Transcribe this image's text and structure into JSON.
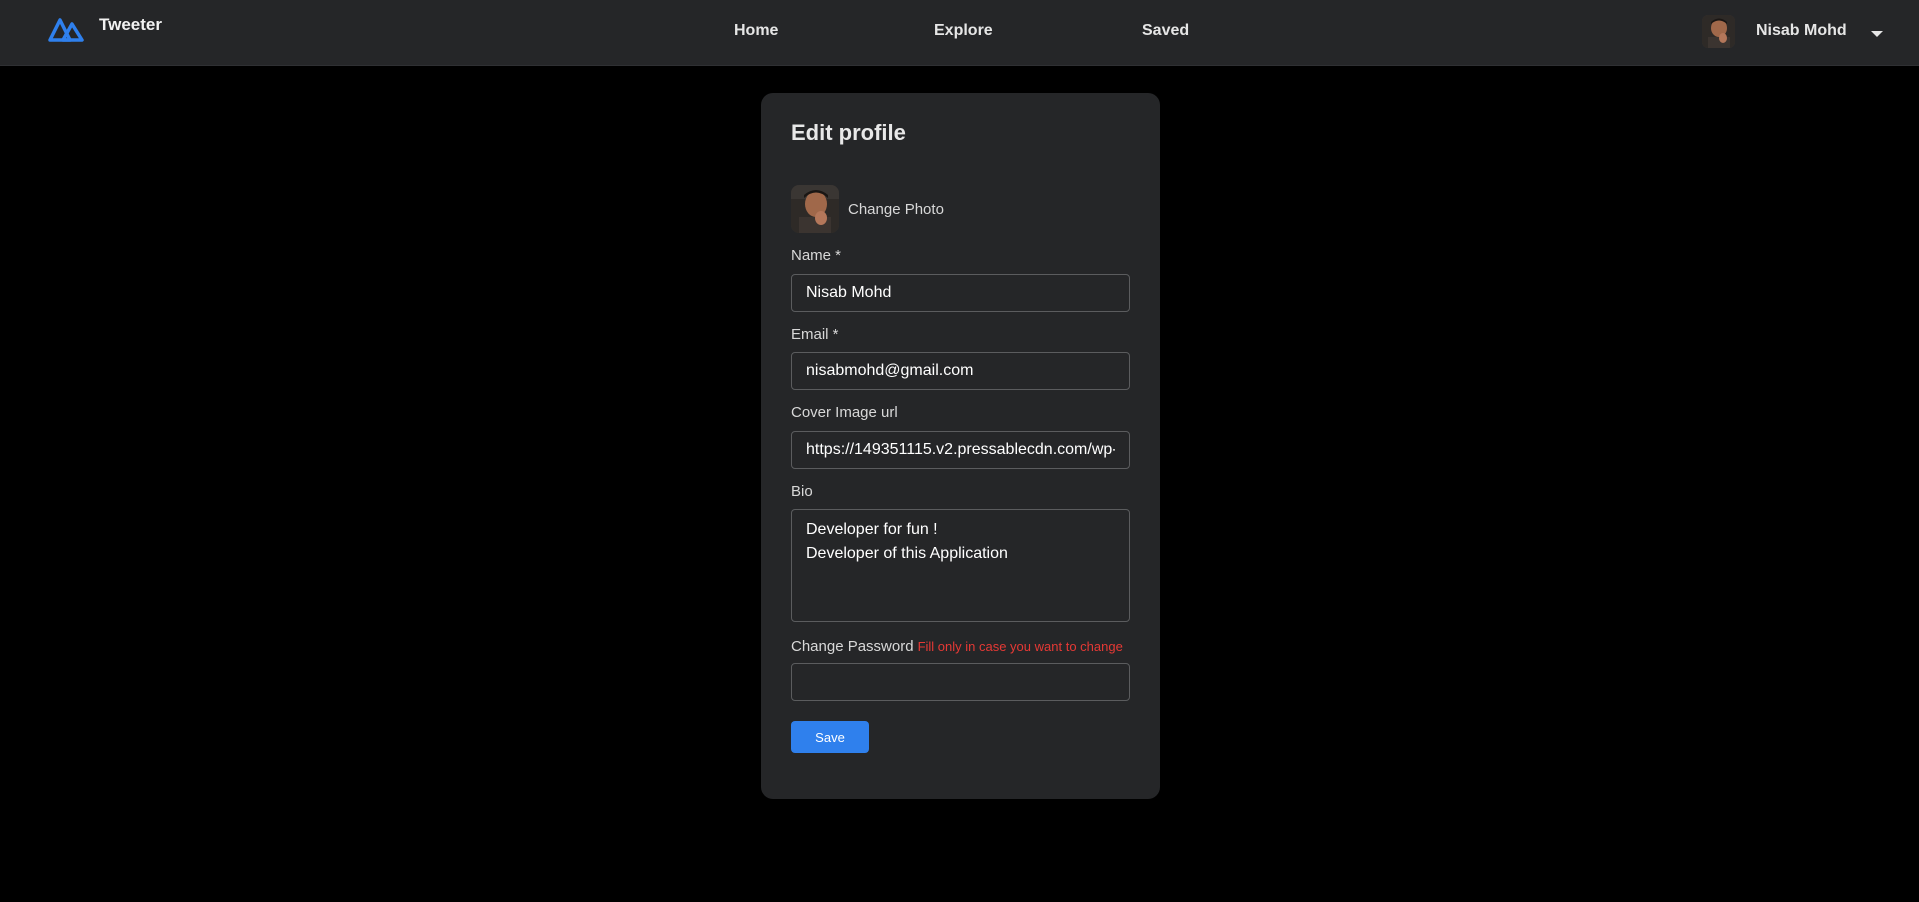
{
  "navbar": {
    "brand_name": "Tweeter",
    "links": {
      "home": "Home",
      "explore": "Explore",
      "saved": "Saved"
    },
    "user_name": "Nisab Mohd"
  },
  "edit_profile": {
    "title": "Edit profile",
    "change_photo_label": "Change Photo",
    "name_label": "Name *",
    "name_value": "Nisab Mohd",
    "email_label": "Email *",
    "email_value": "nisabmohd@gmail.com",
    "cover_label": "Cover Image url",
    "cover_value": "https://149351115.v2.pressablecdn.com/wp-",
    "bio_label": "Bio",
    "bio_value": "Developer for fun !\nDeveloper of this Application",
    "password_label": "Change Password",
    "password_hint": "Fill only in case you want to change",
    "password_value": "",
    "save_label": "Save"
  },
  "colors": {
    "accent": "#2f80ed",
    "warning": "#e53935",
    "card_bg": "#252628",
    "page_bg": "#000000"
  },
  "icons": {
    "brand": "tweeter-logo-icon",
    "caret": "caret-down-icon"
  }
}
